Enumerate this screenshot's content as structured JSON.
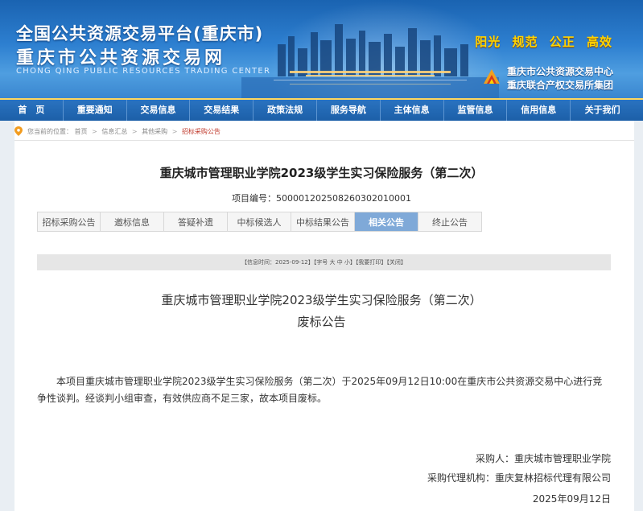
{
  "header": {
    "title_cn": "全国公共资源交易平台(重庆市)",
    "title_cn_2": "重庆市公共资源交易网",
    "title_en": "CHONG QING PUBLIC RESOURCES TRADING CENTER",
    "slogans": [
      "阳光",
      "规范",
      "公正",
      "高效"
    ],
    "org_line1": "重庆市公共资源交易中心",
    "org_line2": "重庆联合产权交易所集团"
  },
  "nav": {
    "items": [
      "首　页",
      "重要通知",
      "交易信息",
      "交易结果",
      "政策法规",
      "服务导航",
      "主体信息",
      "监管信息",
      "信用信息",
      "关于我们"
    ]
  },
  "breadcrumb": {
    "prefix": "您当前的位置：",
    "items": [
      "首页",
      "信息汇总",
      "其他采购",
      "招标采购公告"
    ]
  },
  "project": {
    "title": "重庆城市管理职业学院2023级学生实习保险服务（第二次）",
    "code": "项目编号：500001202508260302010001"
  },
  "tabs": {
    "items": [
      "招标采购公告",
      "邀标信息",
      "答疑补遗",
      "中标候选人",
      "中标结果公告",
      "相关公告",
      "终止公告"
    ],
    "active_index": 5
  },
  "infobar": {
    "text": "【信息时间：2025-09-12】【字号 大 中 小】【我要打印】【关闭】"
  },
  "doc": {
    "title_line1": "重庆城市管理职业学院2023级学生实习保险服务（第二次）",
    "title_line2": "废标公告",
    "body": "本项目重庆城市管理职业学院2023级学生实习保险服务（第二次）于2025年09月12日10:00在重庆市公共资源交易中心进行竞争性谈判。经谈判小组审查，有效供应商不足三家，故本项目废标。",
    "purchaser": "采购人：重庆城市管理职业学院",
    "agent": "采购代理机构：重庆复林招标代理有限公司",
    "date": "2025年09月12日"
  },
  "colors": {
    "header_blue": "#2d7fd0",
    "nav_blue": "#1c5fa8",
    "slogan_yellow": "#ffd400",
    "tab_active": "#7fa9d8",
    "breadcrumb_current": "#c0392b"
  }
}
